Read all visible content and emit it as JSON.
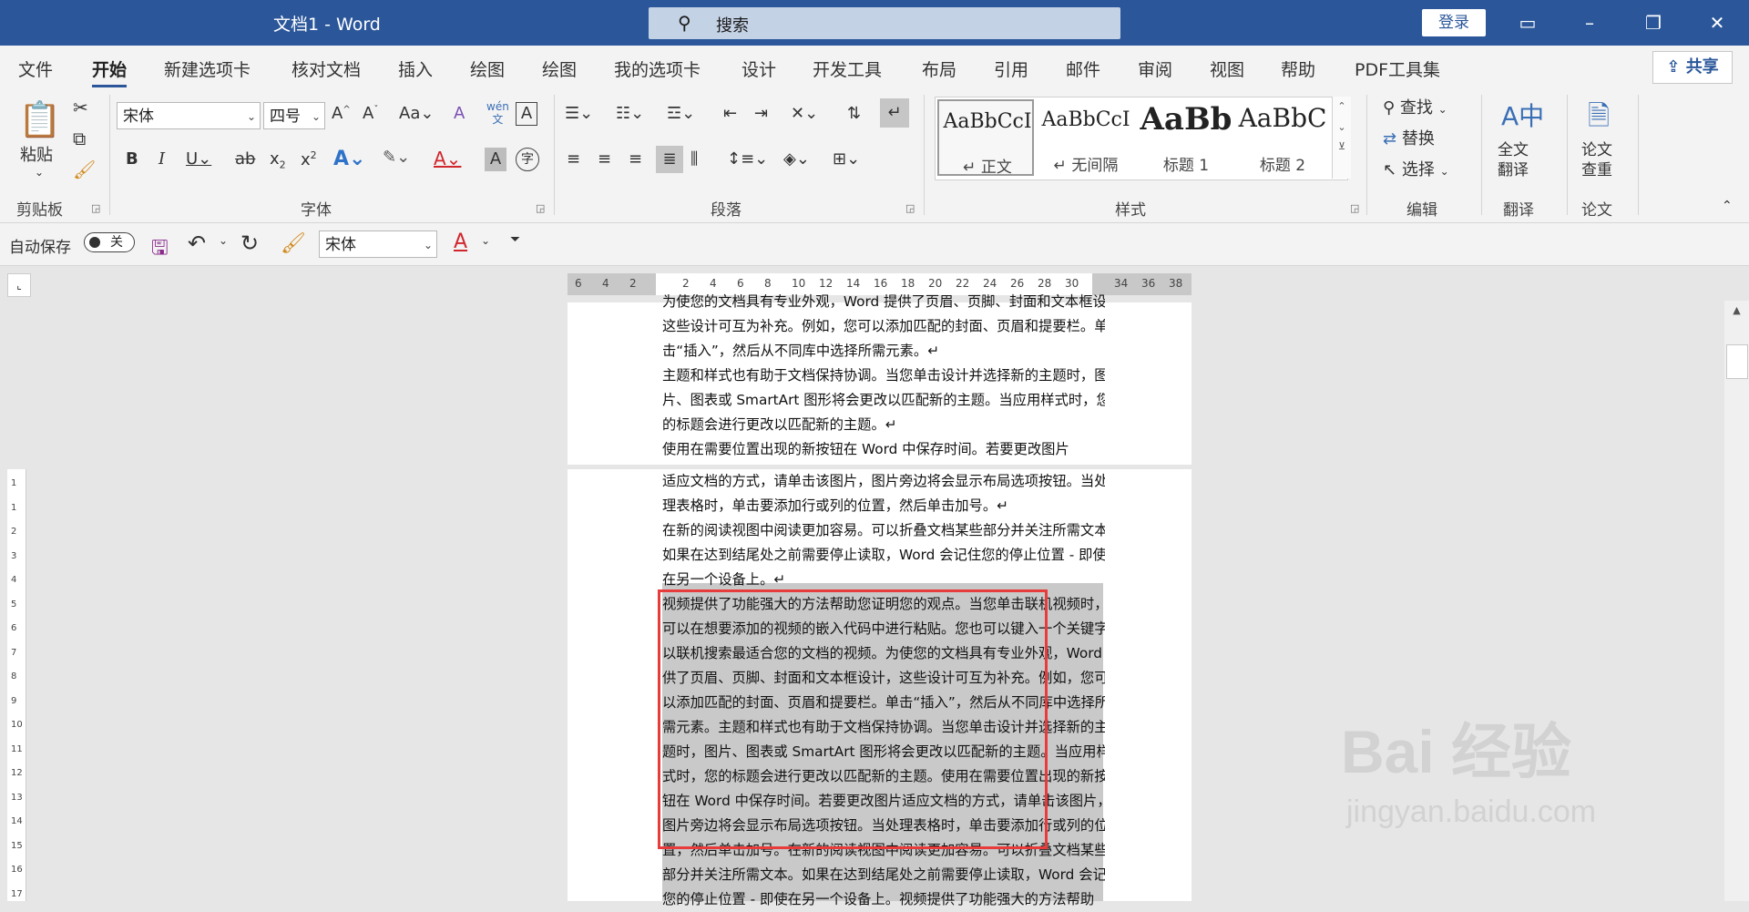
{
  "titlebar": {
    "doc_title": "文档1  -  Word",
    "search_placeholder": "搜索",
    "login": "登录"
  },
  "tabs": [
    "文件",
    "开始",
    "新建选项卡",
    "核对文档",
    "插入",
    "绘图",
    "绘图",
    "我的选项卡",
    "设计",
    "开发工具",
    "布局",
    "引用",
    "邮件",
    "审阅",
    "视图",
    "帮助",
    "PDF工具集"
  ],
  "active_tab": "开始",
  "share": "共享",
  "ribbon": {
    "clipboard": {
      "paste": "粘贴",
      "label": "剪贴板"
    },
    "font": {
      "name": "宋体",
      "size": "四号",
      "label": "字体"
    },
    "paragraph": {
      "label": "段落"
    },
    "styles": {
      "label": "样式",
      "items": [
        {
          "preview": "AaBbCcI",
          "name": "↵ 正文"
        },
        {
          "preview": "AaBbCcI",
          "name": "↵ 无间隔"
        },
        {
          "preview": "AaBb",
          "name": "标题 1"
        },
        {
          "preview": "AaBbC",
          "name": "标题 2"
        }
      ]
    },
    "editing": {
      "find": "查找",
      "replace": "替换",
      "select": "选择",
      "label": "编辑"
    },
    "translate": {
      "button": "全文\n翻译",
      "label": "翻译"
    },
    "paper": {
      "button": "论文\n查重",
      "label": "论文"
    }
  },
  "qat": {
    "autosave": "自动保存",
    "autosave_state": "关",
    "font": "宋体"
  },
  "ruler": {
    "h_left": [
      "6",
      "4",
      "2"
    ],
    "h_marks": [
      "2",
      "4",
      "6",
      "8",
      "10",
      "12",
      "14",
      "16",
      "18",
      "20",
      "22",
      "24",
      "26",
      "28",
      "30"
    ],
    "h_right": [
      "34",
      "36",
      "38"
    ],
    "v_marks": [
      "1",
      "1",
      "2",
      "3",
      "4",
      "5",
      "6",
      "7",
      "8",
      "9",
      "10",
      "11",
      "12",
      "13",
      "14",
      "15",
      "16",
      "17"
    ]
  },
  "page1_lines": [
    "为使您的文档具有专业外观，Word 提供了页眉、页脚、封面和文本框设计，",
    "这些设计可互为补充。例如，您可以添加匹配的封面、页眉和提要栏。单",
    "击“插入”，然后从不同库中选择所需元素。↵",
    "主题和样式也有助于文档保持协调。当您单击设计并选择新的主题时，图",
    "片、图表或 SmartArt 图形将会更改以匹配新的主题。当应用样式时，您",
    "的标题会进行更改以匹配新的主题。↵",
    "使用在需要位置出现的新按钮在 Word 中保存时间。若要更改图片"
  ],
  "page2_lines": [
    "适应文档的方式，请单击该图片，图片旁边将会显示布局选项按钮。当处",
    "理表格时，单击要添加行或列的位置，然后单击加号。↵",
    "在新的阅读视图中阅读更加容易。可以折叠文档某些部分并关注所需文本。",
    "如果在达到结尾处之前需要停止读取，Word 会记住您的停止位置 - 即使",
    "在另一个设备上。↵",
    "视频提供了功能强大的方法帮助您证明您的观点。当您单击联机视频时，",
    "可以在想要添加的视频的嵌入代码中进行粘贴。您也可以键入一个关键字",
    "以联机搜索最适合您的文档的视频。为使您的文档具有专业外观，Word 提",
    "供了页眉、页脚、封面和文本框设计，这些设计可互为补充。例如，您可",
    "以添加匹配的封面、页眉和提要栏。单击“插入”，然后从不同库中选择所",
    "需元素。主题和样式也有助于文档保持协调。当您单击设计并选择新的主",
    "题时，图片、图表或 SmartArt 图形将会更改以匹配新的主题。当应用样",
    "式时，您的标题会进行更改以匹配新的主题。使用在需要位置出现的新按",
    "钮在 Word 中保存时间。若要更改图片适应文档的方式，请单击该图片，",
    "图片旁边将会显示布局选项按钮。当处理表格时，单击要添加行或列的位",
    "置，然后单击加号。在新的阅读视图中阅读更加容易。可以折叠文档某些",
    "部分并关注所需文本。如果在达到结尾处之前需要停止读取，Word 会记住",
    "您的停止位置 - 即使在另一个设备上。视频提供了功能强大的方法帮助"
  ],
  "watermark": {
    "logo": "Bai 经验",
    "url": "jingyan.baidu.com"
  },
  "colors": {
    "accent": "#2b579a",
    "highlight_box": "#e83b3b",
    "selection": "#c9c9c9"
  }
}
